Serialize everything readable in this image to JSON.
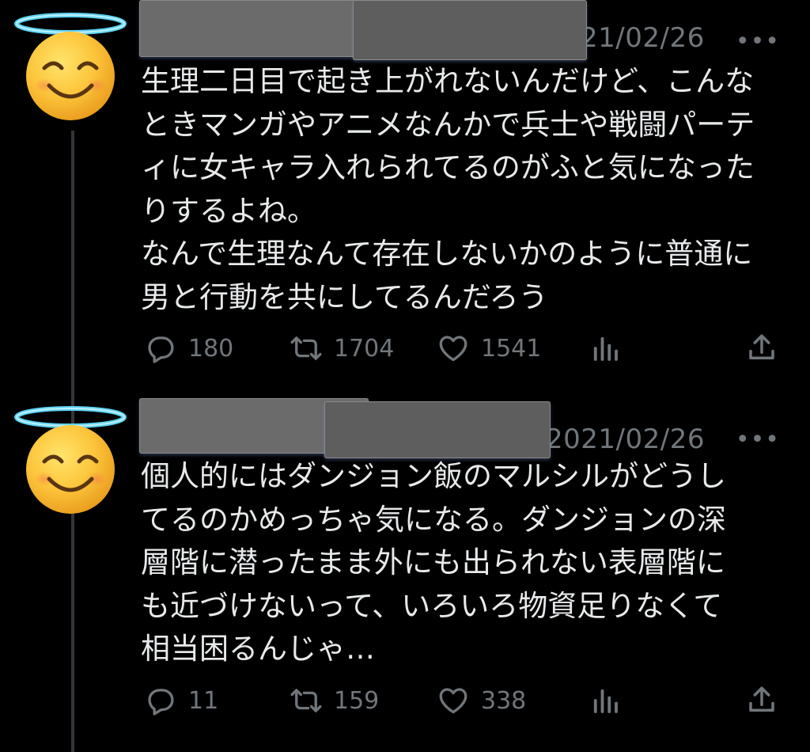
{
  "tweets": [
    {
      "date": "21/02/26",
      "more": "•••",
      "avatar_icon": "smiling-face-with-halo-icon",
      "text_lines": [
        "生理二日目で起き上がれないんだけど、こんな",
        "ときマンガやアニメなんかで兵士や戦闘パーテ",
        "ィに女キャラ入れられてるのがふと気になった",
        "りするよね。",
        "なんで生理なんて存在しないかのように普通に",
        "男と行動を共にしてるんだろう"
      ],
      "stats": {
        "replies": "180",
        "retweets": "1704",
        "likes": "1541"
      }
    },
    {
      "date": "2021/02/26",
      "more": "•••",
      "avatar_icon": "smiling-face-with-halo-icon",
      "text_lines": [
        "個人的にはダンジョン飯のマルシルがどうし",
        "てるのかめっちゃ気になる。ダンジョンの深",
        "層階に潜ったまま外にも出られない表層階に",
        "も近づけないって、いろいろ物資足りなくて",
        "相当困るんじゃ…"
      ],
      "stats": {
        "replies": "11",
        "retweets": "159",
        "likes": "338"
      }
    }
  ],
  "colors": {
    "background": "#000000",
    "text": "#e7e9ea",
    "muted": "#71767b",
    "thread_line": "#333639",
    "redaction": "#6b6b6b"
  }
}
